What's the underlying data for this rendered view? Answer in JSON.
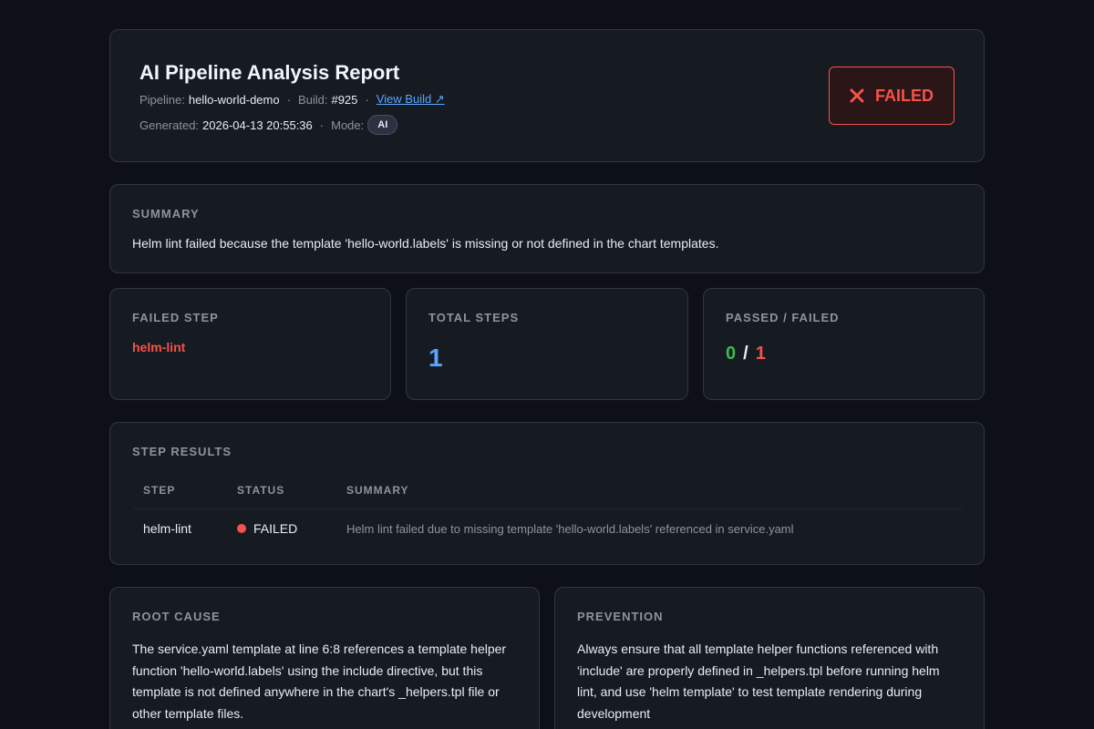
{
  "header": {
    "title": "AI Pipeline Analysis Report",
    "pipeline_label": "Pipeline:",
    "pipeline_value": "hello-world-demo",
    "build_label": "Build:",
    "build_value": "#925",
    "view_build_link": "View Build ↗",
    "generated_label": "Generated:",
    "generated_value": "2026-04-13 20:55:36",
    "mode_label": "Mode:",
    "mode_value": "AI",
    "separator": "·",
    "status": "FAILED",
    "status_icon": "x-icon"
  },
  "summary": {
    "label": "SUMMARY",
    "text": "Helm lint failed because the template 'hello-world.labels' is missing or not defined in the chart templates."
  },
  "stats": {
    "failed_step_label": "FAILED STEP",
    "failed_step_value": "helm-lint",
    "total_steps_label": "TOTAL STEPS",
    "total_steps_value": "1",
    "passed_failed_label": "PASSED / FAILED",
    "passed_value": "0",
    "slash": "/",
    "failed_value": "1"
  },
  "step_results": {
    "label": "STEP RESULTS",
    "columns": [
      "STEP",
      "STATUS",
      "SUMMARY"
    ],
    "rows": [
      {
        "step": "helm-lint",
        "status": "FAILED",
        "summary": "Helm lint failed due to missing template 'hello-world.labels' referenced in service.yaml"
      }
    ]
  },
  "root_cause": {
    "label": "ROOT CAUSE",
    "text": "The service.yaml template at line 6:8 references a template helper function 'hello-world.labels' using the include directive, but this template is not defined anywhere in the chart's _helpers.tpl file or other template files."
  },
  "prevention": {
    "label": "PREVENTION",
    "text": "Always ensure that all template helper functions referenced with 'include' are properly defined in _helpers.tpl before running helm lint, and use 'helm template' to test template rendering during development"
  },
  "colors": {
    "background": "#0d1117",
    "card": "#161b22",
    "failed": "#f85149",
    "passed": "#3fb950",
    "accent": "#58a6ff"
  }
}
